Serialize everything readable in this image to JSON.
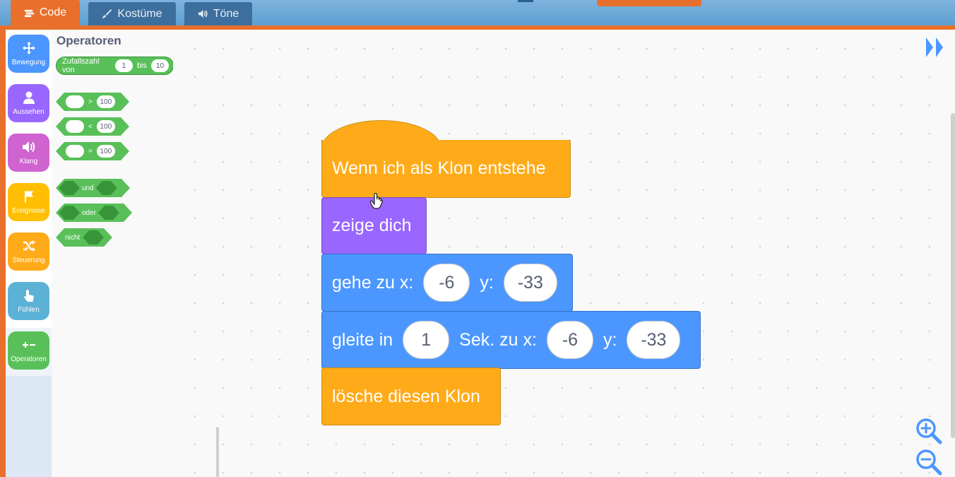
{
  "tabs": [
    {
      "label": "Code",
      "icon": "code-icon"
    },
    {
      "label": "Kostüme",
      "icon": "brush-icon"
    },
    {
      "label": "Töne",
      "icon": "speaker-icon"
    }
  ],
  "categories": [
    {
      "label": "Bewegung",
      "icon": "move-icon",
      "color": "#4c97ff"
    },
    {
      "label": "Aussehen",
      "icon": "person-icon",
      "color": "#9966ff"
    },
    {
      "label": "Klang",
      "icon": "speaker-icon",
      "color": "#cf63cf"
    },
    {
      "label": "Ereignisse",
      "icon": "flag-icon",
      "color": "#ffbf00"
    },
    {
      "label": "Steuerung",
      "icon": "shuffle-icon",
      "color": "#ffab19"
    },
    {
      "label": "Fühlen",
      "icon": "touch-icon",
      "color": "#5cb1d6"
    },
    {
      "label": "Operatoren",
      "icon": "plus-minus-icon",
      "color": "#59c059"
    }
  ],
  "flyout": {
    "title": "Operatoren",
    "random": {
      "label_from": "Zufallszahl von",
      "from": "1",
      "label_to": "bis",
      "to": "10"
    },
    "compare_gt": {
      "op": ">",
      "right": "100"
    },
    "compare_lt": {
      "op": "<",
      "right": "100"
    },
    "compare_eq": {
      "op": "=",
      "right": "100"
    },
    "and_label": "und",
    "or_label": "oder",
    "not_label": "nicht"
  },
  "script": {
    "hat_label": "Wenn ich als Klon entstehe",
    "show_label": "zeige dich",
    "goto": {
      "label_x": "gehe zu x:",
      "x": "-6",
      "label_y": "y:",
      "y": "-33"
    },
    "glide": {
      "label_in": "gleite in",
      "secs": "1",
      "label_x": "Sek. zu x:",
      "x": "-6",
      "label_y": "y:",
      "y": "-33"
    },
    "delete_label": "lösche diesen Klon"
  },
  "colors": {
    "accent_orange": "#e8702c",
    "operators_green": "#59c059",
    "motion_blue": "#4c97ff",
    "looks_purple": "#9966ff",
    "control_orange": "#ffab19"
  }
}
